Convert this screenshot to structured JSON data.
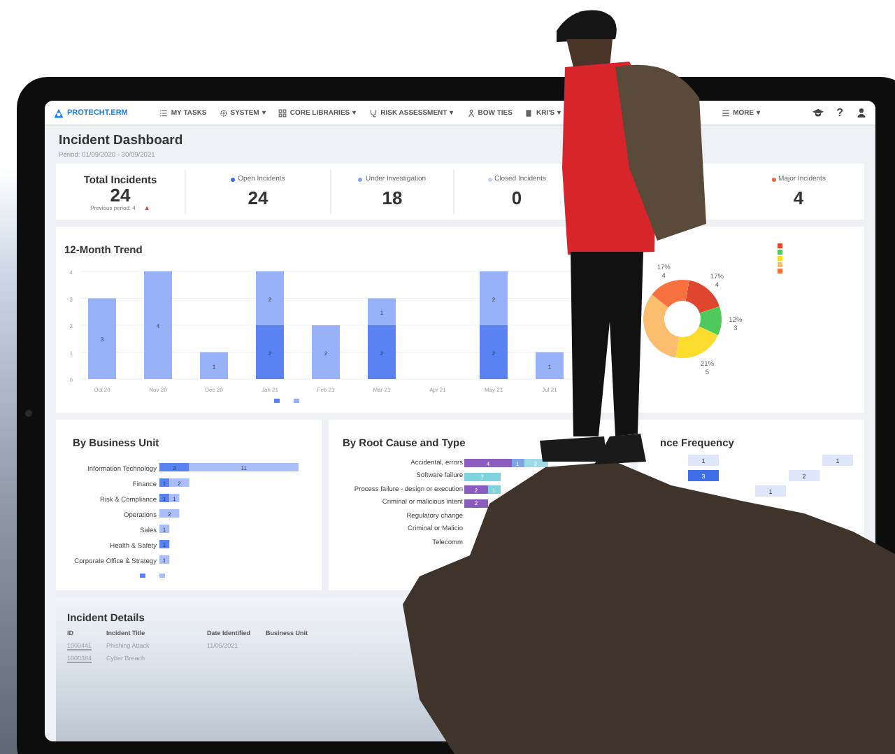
{
  "nav": {
    "logo": "PROTECHT.ERM",
    "items": [
      {
        "label": "MY TASKS"
      },
      {
        "label": "SYSTEM",
        "caret": "▾"
      },
      {
        "label": "CORE LIBRARIES",
        "caret": "▾"
      },
      {
        "label": "RISK ASSESSMENT",
        "caret": "▾"
      },
      {
        "label": "BOW TIES"
      },
      {
        "label": "KRI'S",
        "caret": "▾"
      }
    ],
    "more": {
      "label": "MORE",
      "caret": "▾"
    },
    "help": "?"
  },
  "header": {
    "title": "Incident Dashboard",
    "period": "Period: 01/09/2020 - 30/09/2021"
  },
  "total": {
    "label": "Total Incidents",
    "value": "24",
    "previous": "Previous period: 4",
    "change_icon": "▲"
  },
  "kpis": [
    {
      "label": "Open Incidents",
      "value": "24",
      "color": "#3f6fe8"
    },
    {
      "label": "Under Investigation",
      "value": "18",
      "color": "#8aa6f2"
    },
    {
      "label": "Closed Incidents",
      "value": "0",
      "color": "#c3cff5"
    },
    {
      "label": "Major Incidents",
      "value": "4",
      "color": "#f0643c"
    }
  ],
  "trend": {
    "title": "12-Month Trend",
    "chart_data": {
      "type": "bar",
      "stacked": true,
      "grid": true,
      "categories": [
        "Oct 20",
        "Nov 20",
        "Dec 20",
        "Jan 21",
        "Feb 21",
        "Mar 21",
        "Apr 21",
        "May 21",
        "Jul 21"
      ],
      "yticks": [
        0,
        1,
        2,
        3,
        4
      ],
      "ylim": [
        0,
        4
      ],
      "data_labels": true,
      "series": [
        {
          "color": "#5b82f2",
          "values": [
            null,
            null,
            null,
            2,
            null,
            2,
            null,
            2,
            null
          ]
        },
        {
          "color": "#98b2fa",
          "values": [
            3,
            4,
            1,
            2,
            2,
            1,
            null,
            2,
            1
          ]
        }
      ]
    }
  },
  "donut": {
    "chart_data": {
      "type": "donut",
      "values": [
        17,
        12,
        21,
        33,
        17
      ]
    },
    "slices": [
      {
        "color": "#de4630",
        "percent": "17%",
        "count": "4"
      },
      {
        "color": "#4ec95c",
        "percent": "12%",
        "count": "3"
      },
      {
        "color": "#fcdc2c",
        "percent": "21%",
        "count": "5"
      },
      {
        "color": "#fcbd6e"
      },
      {
        "color": "#f7703f",
        "percent": "17%",
        "count": "4"
      }
    ]
  },
  "business_unit": {
    "title": "By Business Unit",
    "chart_data": {
      "type": "bar",
      "orientation": "horizontal",
      "stacked": true,
      "data_labels": true,
      "categories": [
        "Information Technology",
        "Finance",
        "Risk & Compliance",
        "Operations",
        "Sales",
        "Health & Safety",
        "Corporate Office & Strategy"
      ],
      "series": [
        {
          "color": "#5b82f2",
          "values": [
            3,
            1,
            1,
            null,
            null,
            1,
            null
          ]
        },
        {
          "color": "#a9befa",
          "values": [
            11,
            2,
            1,
            2,
            1,
            null,
            1
          ]
        }
      ]
    }
  },
  "root_cause": {
    "title": "By Root Cause and Type",
    "rows": [
      {
        "label": "Accidental, errors",
        "segments": [
          {
            "text": "4",
            "color": "#8a5cc0"
          },
          {
            "text": "1",
            "color": "#7fa4e8"
          },
          {
            "text": "2",
            "color": "#9fdbe6"
          }
        ]
      },
      {
        "label": "Software failure",
        "segments": [
          {
            "text": "3",
            "color": "#7fd3df"
          }
        ]
      },
      {
        "label": "Process failure - design or execution",
        "segments": [
          {
            "text": "2",
            "color": "#8a5cc0"
          },
          {
            "text": "1",
            "color": "#7fd3df"
          }
        ]
      },
      {
        "label": "Criminal or malicious intent",
        "segments": [
          {
            "text": "2",
            "color": "#8a5cc0"
          }
        ]
      },
      {
        "label": "Regulatory change",
        "segments": []
      },
      {
        "label": "Criminal or Malicio",
        "segments": []
      },
      {
        "label": "Telecomm",
        "segments": []
      }
    ]
  },
  "frequency": {
    "title": "nce Frequency",
    "rows": [
      [
        {
          "kind": "empty"
        },
        {
          "kind": "light",
          "text": "1"
        },
        {
          "kind": "empty"
        },
        {
          "kind": "empty"
        },
        {
          "kind": "empty"
        },
        {
          "kind": "light",
          "text": "1"
        }
      ],
      [
        {
          "kind": "empty"
        },
        {
          "kind": "dark",
          "text": "3"
        },
        {
          "kind": "empty"
        },
        {
          "kind": "empty"
        },
        {
          "kind": "light",
          "text": "2"
        },
        {
          "kind": "empty"
        }
      ],
      [
        {
          "kind": "empty"
        },
        {
          "kind": "empty"
        },
        {
          "kind": "empty"
        },
        {
          "kind": "light",
          "text": "1"
        },
        {
          "kind": "empty"
        },
        {
          "kind": "empty"
        }
      ]
    ]
  },
  "details": {
    "title": "Incident Details",
    "columns": [
      "ID",
      "Incident Title",
      "Date Identified",
      "Business Unit"
    ],
    "rows": [
      [
        "1000441",
        "Phishing Attack",
        "11/05/2021"
      ],
      [
        "1000384",
        "Cyber Breach"
      ]
    ]
  }
}
